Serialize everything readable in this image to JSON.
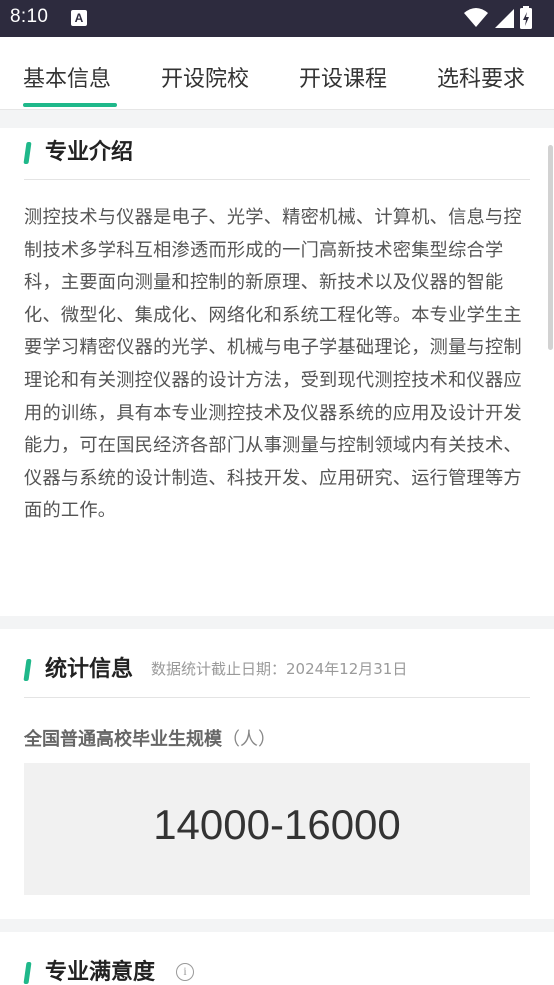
{
  "status_bar": {
    "time": "8:10",
    "notification_badge": "A"
  },
  "tabs": [
    {
      "label": "基本信息",
      "active": true
    },
    {
      "label": "开设院校",
      "active": false
    },
    {
      "label": "开设课程",
      "active": false
    },
    {
      "label": "选科要求",
      "active": false
    }
  ],
  "intro": {
    "title": "专业介绍",
    "body": "测控技术与仪器是电子、光学、精密机械、计算机、信息与控制技术多学科互相渗透而形成的一门高新技术密集型综合学科，主要面向测量和控制的新原理、新技术以及仪器的智能化、微型化、集成化、网络化和系统工程化等。本专业学生主要学习精密仪器的光学、机械与电子学基础理论，测量与控制理论和有关测控仪器的设计方法，受到现代测控技术和仪器应用的训练，具有本专业测控技术及仪器系统的应用及设计开发能力，可在国民经济各部门从事测量与控制领域内有关技术、仪器与系统的设计制造、科技开发、应用研究、运行管理等方面的工作。"
  },
  "stats": {
    "title": "统计信息",
    "subtitle": "数据统计截止日期：2024年12月31日",
    "graduates_label": "全国普通高校毕业生规模",
    "graduates_unit": "（人）",
    "graduates_value": "14000-16000"
  },
  "satisfaction": {
    "title": "专业满意度",
    "info_glyph": "i"
  },
  "colors": {
    "accent": "#1fb88a",
    "status_bar": "#2d2b3e"
  }
}
